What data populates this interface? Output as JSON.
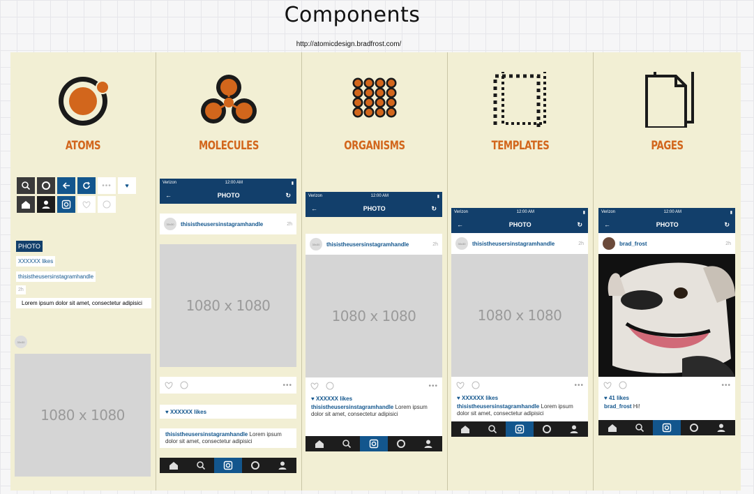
{
  "header": {
    "title": "Components",
    "url": "http://atomicdesign.bradfrost.com/"
  },
  "columns": [
    {
      "name": "ATOMS",
      "icon": "atom-icon"
    },
    {
      "name": "MOLECULES",
      "icon": "molecule-icon"
    },
    {
      "name": "ORGANISMS",
      "icon": "organism-icon"
    },
    {
      "name": "TEMPLATES",
      "icon": "template-icon"
    },
    {
      "name": "PAGES",
      "icon": "pages-icon"
    }
  ],
  "atoms": {
    "photo_label": "PHOTO",
    "likes": "XXXXXX likes",
    "handle": "thisistheusersinstagramhandle",
    "time": "2h",
    "caption": "Lorem ipsum dolor sit amet, consectetur adipisici",
    "avatar_text": "30x30",
    "placeholder": "1080 x 1080"
  },
  "phone": {
    "carrier": "Verizon",
    "clock": "12:00 AM",
    "nav_title": "PHOTO",
    "handle": "thisistheusersinstagramhandle",
    "time": "2h",
    "avatar_text": "30x30",
    "placeholder": "1080 x 1080",
    "likes": "XXXXXX likes",
    "caption_handle": "thisistheusersinstagramhandle",
    "caption_text": "Lorem ipsum dolor sit amet, consectetur adipisici"
  },
  "page": {
    "handle": "brad_frost",
    "time": "2h",
    "likes": "41 likes",
    "caption_handle": "brad_frost",
    "caption_text": "Hi!"
  },
  "colors": {
    "board": "#f2efd4",
    "accent": "#d2661c",
    "nav": "#123f6b",
    "link": "#13568d"
  }
}
